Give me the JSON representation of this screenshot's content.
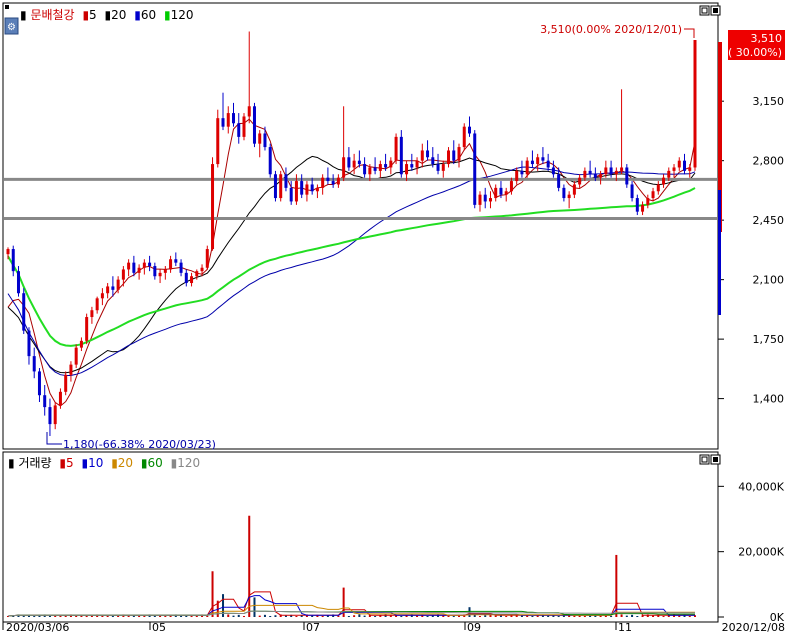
{
  "price_panel": {
    "legend_title": "문배철강",
    "legend_items": [
      {
        "label": "5",
        "color": "#cc0000"
      },
      {
        "label": "20",
        "color": "#000000"
      },
      {
        "label": "60",
        "color": "#0000cc"
      },
      {
        "label": "120",
        "color": "#00cc00"
      }
    ],
    "current_price_label": "3,510",
    "current_change_label": "( 30.00%)",
    "high_annotation": "3,510(0.00% 2020/12/01)",
    "low_annotation": "1,180(-66.38% 2020/03/23)",
    "y_ticks": [
      "3,150",
      "2,800",
      "2,450",
      "2,100",
      "1,750",
      "1,400"
    ],
    "y_tick_values": [
      3150,
      2800,
      2450,
      2100,
      1750,
      1400
    ]
  },
  "volume_panel": {
    "legend_title": "거래량",
    "legend_items": [
      {
        "label": "5",
        "color": "#cc0000"
      },
      {
        "label": "10",
        "color": "#0000cc"
      },
      {
        "label": "20",
        "color": "#cc8800"
      },
      {
        "label": "60",
        "color": "#008800"
      },
      {
        "label": "120",
        "color": "#888888"
      }
    ],
    "y_ticks": [
      "40,000K",
      "20,000K",
      "0K"
    ],
    "y_tick_values": [
      40000,
      20000,
      0
    ]
  },
  "x_axis": {
    "labels": [
      "2020/03/06",
      "05",
      "07",
      "09",
      "11",
      "2020/12/08"
    ]
  },
  "colors": {
    "up": "#dd0000",
    "down": "#0000cc",
    "ma5": "#aa0000",
    "ma20": "#000000",
    "ma60": "#0000aa",
    "ma120": "#22dd22",
    "hline": "#888888",
    "price_box": "#ee0000"
  },
  "chart_data": {
    "type": "candlestick",
    "price_range": [
      1180,
      3510
    ],
    "horizontal_lines": [
      2690,
      2460
    ],
    "candles": [
      [
        2250,
        2290,
        2220,
        2280
      ],
      [
        2280,
        2300,
        2120,
        2150
      ],
      [
        2150,
        2180,
        2000,
        2020
      ],
      [
        2020,
        2050,
        1780,
        1800
      ],
      [
        1800,
        1820,
        1600,
        1650
      ],
      [
        1650,
        1700,
        1520,
        1560
      ],
      [
        1560,
        1580,
        1380,
        1420
      ],
      [
        1420,
        1480,
        1300,
        1350
      ],
      [
        1350,
        1400,
        1180,
        1250
      ],
      [
        1250,
        1380,
        1220,
        1360
      ],
      [
        1360,
        1460,
        1340,
        1440
      ],
      [
        1440,
        1560,
        1420,
        1540
      ],
      [
        1540,
        1620,
        1500,
        1600
      ],
      [
        1600,
        1720,
        1580,
        1700
      ],
      [
        1700,
        1760,
        1680,
        1740
      ],
      [
        1740,
        1900,
        1720,
        1880
      ],
      [
        1880,
        1940,
        1840,
        1920
      ],
      [
        1920,
        2000,
        1900,
        1990
      ],
      [
        1990,
        2050,
        1950,
        2020
      ],
      [
        2020,
        2080,
        1990,
        2060
      ],
      [
        2060,
        2120,
        2000,
        2040
      ],
      [
        2040,
        2120,
        2020,
        2100
      ],
      [
        2100,
        2180,
        2060,
        2160
      ],
      [
        2160,
        2220,
        2120,
        2200
      ],
      [
        2200,
        2240,
        2120,
        2140
      ],
      [
        2140,
        2190,
        2100,
        2170
      ],
      [
        2170,
        2220,
        2130,
        2200
      ],
      [
        2200,
        2240,
        2150,
        2180
      ],
      [
        2180,
        2200,
        2100,
        2120
      ],
      [
        2120,
        2160,
        2080,
        2140
      ],
      [
        2140,
        2180,
        2100,
        2160
      ],
      [
        2160,
        2240,
        2140,
        2220
      ],
      [
        2220,
        2260,
        2180,
        2200
      ],
      [
        2200,
        2220,
        2120,
        2140
      ],
      [
        2140,
        2160,
        2060,
        2080
      ],
      [
        2080,
        2140,
        2060,
        2120
      ],
      [
        2120,
        2160,
        2100,
        2150
      ],
      [
        2150,
        2190,
        2120,
        2170
      ],
      [
        2170,
        2300,
        2160,
        2280
      ],
      [
        2280,
        2820,
        2270,
        2780
      ],
      [
        2780,
        3100,
        2760,
        3050
      ],
      [
        3050,
        3200,
        2980,
        3000
      ],
      [
        3000,
        3120,
        2960,
        3080
      ],
      [
        3080,
        3140,
        3000,
        3020
      ],
      [
        3020,
        3080,
        2900,
        2940
      ],
      [
        2940,
        3080,
        2920,
        3060
      ],
      [
        3060,
        3560,
        3020,
        3120
      ],
      [
        3120,
        3140,
        2880,
        2900
      ],
      [
        2900,
        2980,
        2820,
        2960
      ],
      [
        2960,
        3000,
        2860,
        2880
      ],
      [
        2880,
        2900,
        2700,
        2720
      ],
      [
        2720,
        2740,
        2560,
        2580
      ],
      [
        2580,
        2740,
        2560,
        2720
      ],
      [
        2720,
        2760,
        2620,
        2640
      ],
      [
        2640,
        2680,
        2540,
        2560
      ],
      [
        2560,
        2720,
        2540,
        2680
      ],
      [
        2680,
        2720,
        2580,
        2600
      ],
      [
        2600,
        2680,
        2560,
        2660
      ],
      [
        2660,
        2700,
        2600,
        2620
      ],
      [
        2620,
        2660,
        2580,
        2640
      ],
      [
        2640,
        2720,
        2600,
        2700
      ],
      [
        2700,
        2760,
        2660,
        2680
      ],
      [
        2680,
        2720,
        2640,
        2660
      ],
      [
        2660,
        2720,
        2640,
        2700
      ],
      [
        2700,
        3120,
        2680,
        2820
      ],
      [
        2820,
        2880,
        2740,
        2760
      ],
      [
        2760,
        2840,
        2720,
        2800
      ],
      [
        2800,
        2860,
        2760,
        2780
      ],
      [
        2780,
        2820,
        2700,
        2720
      ],
      [
        2720,
        2780,
        2680,
        2760
      ],
      [
        2760,
        2820,
        2720,
        2740
      ],
      [
        2740,
        2800,
        2700,
        2780
      ],
      [
        2780,
        2840,
        2740,
        2760
      ],
      [
        2760,
        2820,
        2720,
        2800
      ],
      [
        2800,
        2960,
        2780,
        2940
      ],
      [
        2940,
        2980,
        2700,
        2720
      ],
      [
        2720,
        2800,
        2680,
        2780
      ],
      [
        2780,
        2840,
        2740,
        2760
      ],
      [
        2760,
        2820,
        2720,
        2800
      ],
      [
        2800,
        2900,
        2760,
        2860
      ],
      [
        2860,
        2920,
        2800,
        2820
      ],
      [
        2820,
        2880,
        2760,
        2780
      ],
      [
        2780,
        2840,
        2720,
        2740
      ],
      [
        2740,
        2800,
        2700,
        2780
      ],
      [
        2780,
        2880,
        2760,
        2860
      ],
      [
        2860,
        2920,
        2780,
        2800
      ],
      [
        2800,
        2900,
        2760,
        2880
      ],
      [
        2880,
        3020,
        2860,
        3000
      ],
      [
        3000,
        3060,
        2940,
        2960
      ],
      [
        2960,
        2980,
        2520,
        2540
      ],
      [
        2540,
        2620,
        2500,
        2600
      ],
      [
        2600,
        2640,
        2520,
        2560
      ],
      [
        2560,
        2620,
        2520,
        2580
      ],
      [
        2580,
        2660,
        2560,
        2640
      ],
      [
        2640,
        2680,
        2580,
        2600
      ],
      [
        2600,
        2640,
        2560,
        2620
      ],
      [
        2620,
        2700,
        2600,
        2680
      ],
      [
        2680,
        2760,
        2660,
        2740
      ],
      [
        2740,
        2800,
        2700,
        2720
      ],
      [
        2720,
        2820,
        2700,
        2800
      ],
      [
        2800,
        2860,
        2760,
        2780
      ],
      [
        2780,
        2840,
        2740,
        2820
      ],
      [
        2820,
        2880,
        2780,
        2800
      ],
      [
        2800,
        2840,
        2740,
        2760
      ],
      [
        2760,
        2800,
        2700,
        2720
      ],
      [
        2720,
        2760,
        2620,
        2640
      ],
      [
        2640,
        2660,
        2560,
        2580
      ],
      [
        2580,
        2620,
        2520,
        2600
      ],
      [
        2600,
        2680,
        2580,
        2660
      ],
      [
        2660,
        2720,
        2640,
        2700
      ],
      [
        2700,
        2760,
        2680,
        2740
      ],
      [
        2740,
        2800,
        2700,
        2720
      ],
      [
        2720,
        2760,
        2680,
        2700
      ],
      [
        2700,
        2740,
        2660,
        2720
      ],
      [
        2720,
        2800,
        2700,
        2760
      ],
      [
        2760,
        2800,
        2700,
        2720
      ],
      [
        2720,
        2760,
        2680,
        2740
      ],
      [
        2740,
        3220,
        2720,
        2760
      ],
      [
        2760,
        2780,
        2640,
        2660
      ],
      [
        2660,
        2680,
        2560,
        2580
      ],
      [
        2580,
        2600,
        2480,
        2500
      ],
      [
        2500,
        2560,
        2480,
        2540
      ],
      [
        2540,
        2600,
        2520,
        2580
      ],
      [
        2580,
        2640,
        2560,
        2620
      ],
      [
        2620,
        2680,
        2600,
        2660
      ],
      [
        2660,
        2720,
        2640,
        2700
      ],
      [
        2700,
        2760,
        2680,
        2740
      ],
      [
        2740,
        2780,
        2700,
        2760
      ],
      [
        2760,
        2820,
        2740,
        2800
      ],
      [
        2800,
        2840,
        2720,
        2740
      ],
      [
        2740,
        2780,
        2700,
        2760
      ],
      [
        2760,
        3510,
        2740,
        3510
      ]
    ],
    "volume_scale_max_k": 45000,
    "volume_spikes_k": [
      {
        "index": 39,
        "value": 14000
      },
      {
        "index": 40,
        "value": 5000
      },
      {
        "index": 41,
        "value": 7000
      },
      {
        "index": 46,
        "value": 31000
      },
      {
        "index": 47,
        "value": 6000
      },
      {
        "index": 64,
        "value": 9000
      },
      {
        "index": 88,
        "value": 3000
      },
      {
        "index": 116,
        "value": 19000
      },
      {
        "index": 135,
        "value": 45000
      }
    ]
  }
}
